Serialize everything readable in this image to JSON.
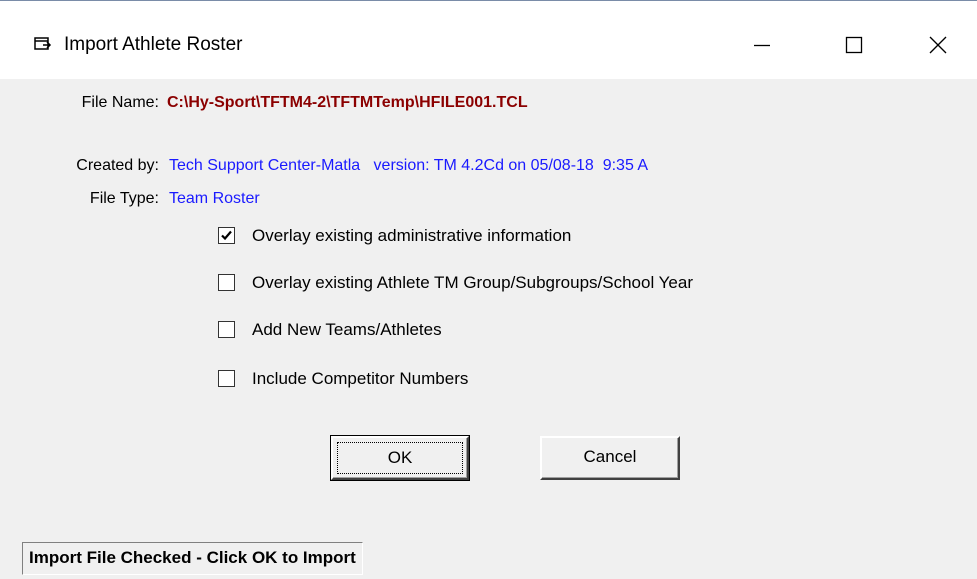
{
  "window": {
    "title": "Import Athlete Roster",
    "icon": "app-window-icon"
  },
  "fields": {
    "file_name_label": "File Name:",
    "file_name_value": "C:\\Hy-Sport\\TFTM4-2\\TFTMTemp\\HFILE001.TCL",
    "created_by_label": "Created by:",
    "created_by_value": "Tech Support Center-Matla   version: TM 4.2Cd on 05/08-18  9:35 A",
    "file_type_label": "File Type:",
    "file_type_value": "Team Roster"
  },
  "options": [
    {
      "label": "Overlay existing administrative information",
      "checked": true
    },
    {
      "label": "Overlay existing Athlete TM Group/Subgroups/School Year",
      "checked": false
    },
    {
      "label": "Add New Teams/Athletes",
      "checked": false
    },
    {
      "label": "Include Competitor Numbers",
      "checked": false
    }
  ],
  "buttons": {
    "ok_label": "OK",
    "cancel_label": "Cancel"
  },
  "status": {
    "text": "Import File Checked - Click OK to Import"
  },
  "colors": {
    "file_name": "#8b0000",
    "info_value": "#1a1aff",
    "background": "#f0f0f0"
  }
}
